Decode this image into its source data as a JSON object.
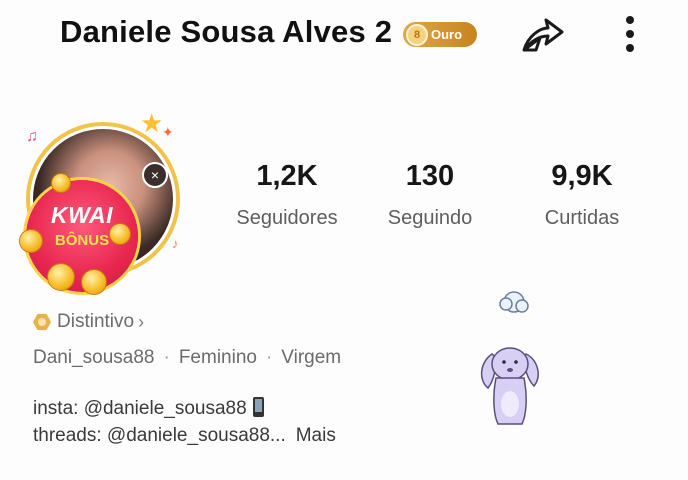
{
  "header": {
    "name": "Daniele Sousa Alves 2",
    "badge_label": "Ouro",
    "badge_icon": "gold-medal-icon",
    "share_icon": "share-arrow-icon",
    "more_icon": "vertical-dots-icon"
  },
  "avatar": {
    "overlay_line1": "KWAI",
    "overlay_line2": "BÔNUS",
    "close_symbol": "×"
  },
  "stats": [
    {
      "value": "1,2K",
      "label": "Seguidores"
    },
    {
      "value": "130",
      "label": "Seguindo"
    },
    {
      "value": "9,9K",
      "label": "Curtidas"
    }
  ],
  "distintivo": {
    "label": "Distintivo",
    "chevron": "›"
  },
  "info": {
    "username": "Dani_sousa88",
    "gender": "Feminino",
    "sign": "Virgem",
    "separator": "·"
  },
  "bio": {
    "line1": "insta: @daniele_sousa88",
    "line2": "threads: @daniele_sousa88...",
    "more": "Mais"
  },
  "colors": {
    "gold_badge": "#d79a32",
    "kwai_red": "#e8264f",
    "ring_gold": "#f1c34b",
    "mascot_lavender": "#d8cff5"
  }
}
